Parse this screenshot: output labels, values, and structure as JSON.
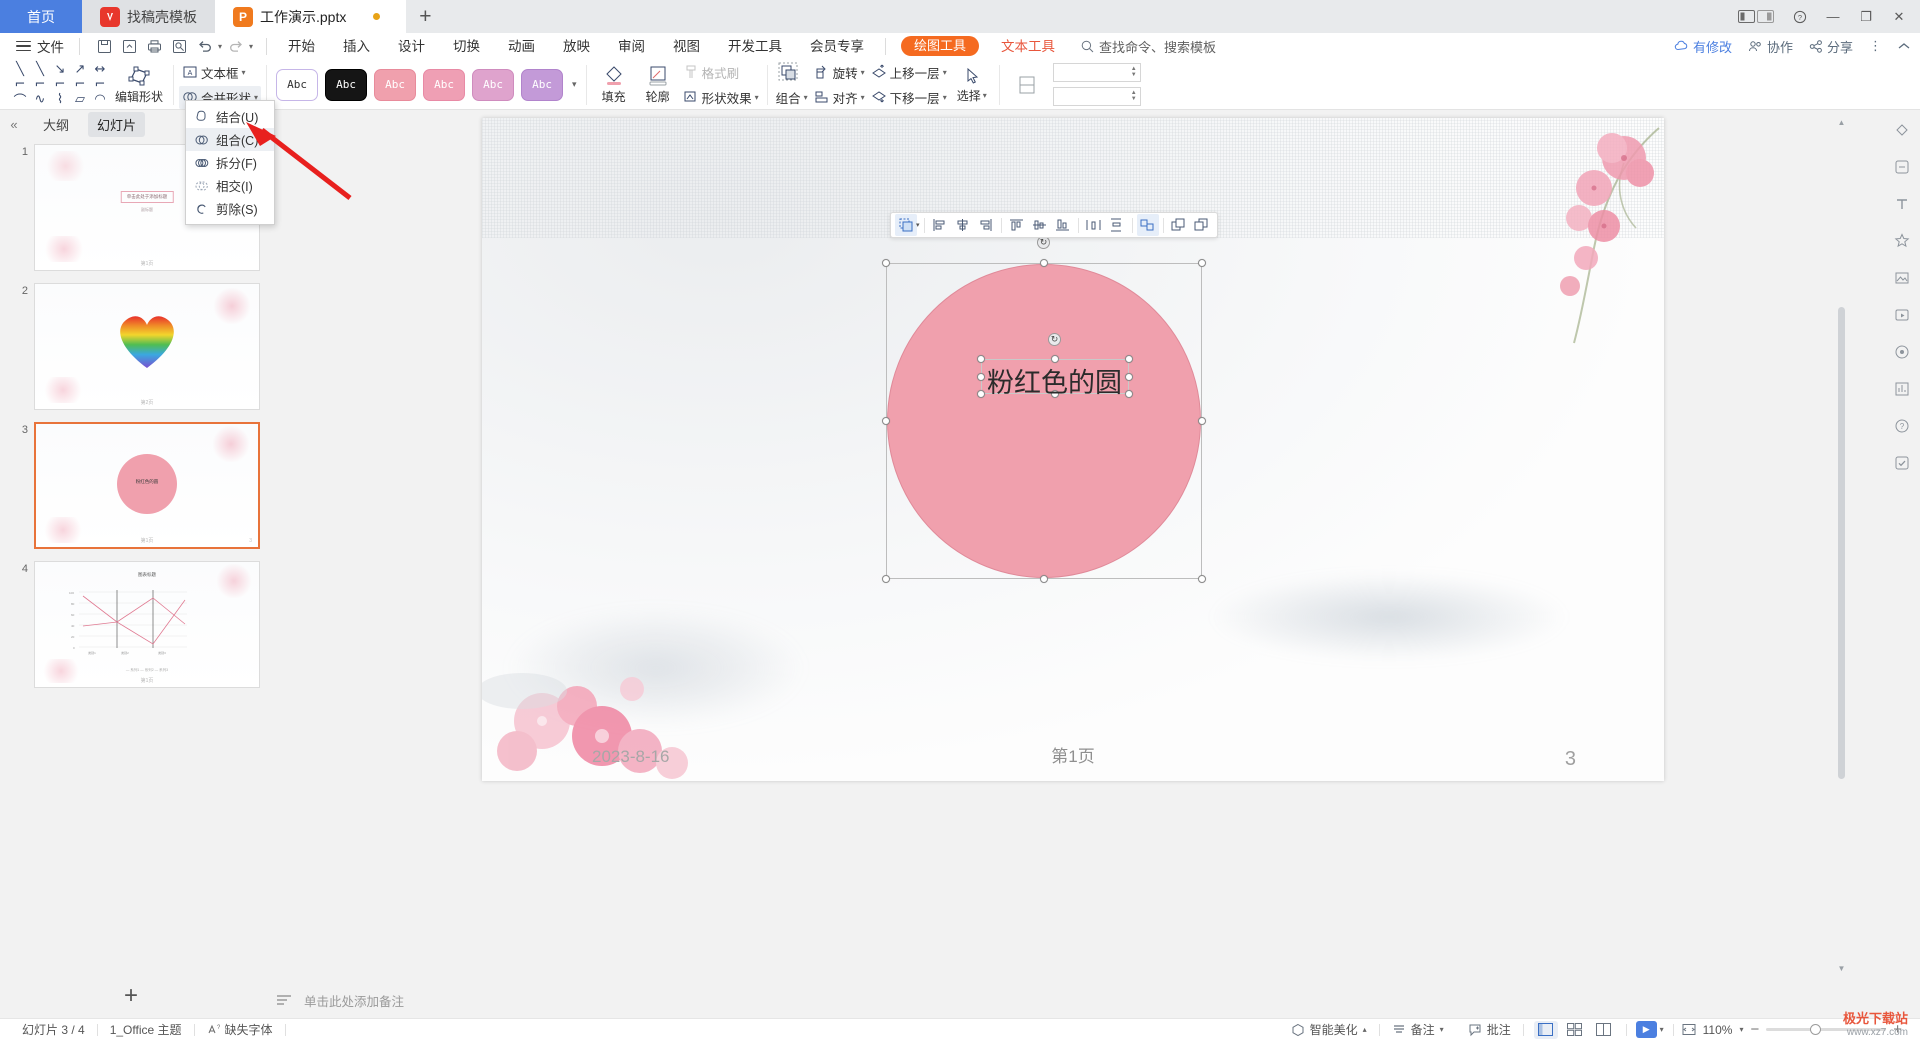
{
  "window": {
    "tabs": [
      {
        "label": "首页",
        "type": "home"
      },
      {
        "label": "找稿壳模板",
        "type": "inactive",
        "icon": "wps-red-icon"
      },
      {
        "label": "工作演示.pptx",
        "type": "active",
        "icon": "ppt-orange-icon"
      }
    ],
    "new_tab": "+",
    "controls": {
      "minimize": "—",
      "maximize": "❐",
      "close": "✕"
    }
  },
  "menubar": {
    "file": "文件",
    "quick_access": [
      "save-icon",
      "save-as-icon",
      "print-icon",
      "print-preview-icon",
      "undo-icon",
      "redo-icon",
      "customize-icon"
    ],
    "ribbon_tabs": [
      {
        "label": "开始"
      },
      {
        "label": "插入"
      },
      {
        "label": "设计"
      },
      {
        "label": "切换"
      },
      {
        "label": "动画"
      },
      {
        "label": "放映"
      },
      {
        "label": "审阅"
      },
      {
        "label": "视图"
      },
      {
        "label": "开发工具"
      },
      {
        "label": "会员专享"
      }
    ],
    "context_tabs": [
      {
        "label": "绘图工具",
        "style": "accent"
      },
      {
        "label": "文本工具",
        "style": "red"
      }
    ],
    "search_placeholder": "查找命令、搜索模板",
    "right_items": [
      {
        "label": "有修改",
        "icon": "cloud-icon"
      },
      {
        "label": "协作",
        "icon": "people-icon"
      },
      {
        "label": "分享",
        "icon": "share-icon"
      }
    ]
  },
  "ribbon": {
    "edit_shape": "编辑形状",
    "text_box": "文本框",
    "merge_shapes": "合并形状",
    "gallery_label": "Abc",
    "gallery_items": [
      {
        "fill": "#ffffff",
        "border": "#c6b6e8",
        "text": "#333333"
      },
      {
        "fill": "#151515",
        "border": "#000000",
        "text": "#ffffff"
      },
      {
        "fill": "#f0a0ad",
        "border": "#e88b9b",
        "text": "#ffffff"
      },
      {
        "fill": "#ef9fb4",
        "border": "#e88aa5",
        "text": "#ffffff"
      },
      {
        "fill": "#dfa3cd",
        "border": "#cf8cbe",
        "text": "#ffffff"
      },
      {
        "fill": "#c39ad8",
        "border": "#b184cc",
        "text": "#ffffff"
      }
    ],
    "fill": "填充",
    "outline": "轮廓",
    "shape_effect": "形状效果",
    "format_painter": "格式刷",
    "group": "组合",
    "align": "对齐",
    "rotate": "旋转",
    "move_up": "上移一层",
    "move_down": "下移一层",
    "select": "选择",
    "size_height": "",
    "size_width": ""
  },
  "dropdown": {
    "items": [
      {
        "label": "结合(U)",
        "icon": "union-icon",
        "highlighted": false
      },
      {
        "label": "组合(C)",
        "icon": "combine-icon",
        "highlighted": true
      },
      {
        "label": "拆分(F)",
        "icon": "fragment-icon",
        "highlighted": false
      },
      {
        "label": "相交(I)",
        "icon": "intersect-icon",
        "highlighted": false
      },
      {
        "label": "剪除(S)",
        "icon": "subtract-icon",
        "highlighted": false
      }
    ]
  },
  "slide_panel": {
    "collapse_icon": "collapse-left-icon",
    "tabs": [
      {
        "label": "大纲",
        "active": false
      },
      {
        "label": "幻灯片",
        "active": true
      }
    ],
    "slides": [
      {
        "num": "1",
        "selected": false,
        "kind": "title",
        "title": "单击此处于添加标题",
        "subtitle": "副标题",
        "footer": "第1页"
      },
      {
        "num": "2",
        "selected": false,
        "kind": "heart",
        "footer": "第2页"
      },
      {
        "num": "3",
        "selected": true,
        "kind": "circle",
        "label": "粉红色的圆",
        "footer": "第1页"
      },
      {
        "num": "4",
        "selected": false,
        "kind": "chart",
        "title": "图表标题",
        "footer": "第1页"
      }
    ],
    "add_slide": "+"
  },
  "slide": {
    "shape_text": "粉红色的圆",
    "footer_date": "2023-8-16",
    "footer_center": "第1页",
    "footer_number": "3",
    "shape_fill": "#f0a0ad"
  },
  "mini_toolbar": {
    "buttons": [
      "group-shapes-icon",
      "align-left-icon",
      "align-center-h-icon",
      "align-right-icon",
      "align-top-icon",
      "align-middle-icon",
      "align-bottom-icon",
      "distribute-h-icon",
      "distribute-v-icon",
      "group-icon",
      "bring-forward-icon",
      "send-backward-icon"
    ]
  },
  "notes": {
    "placeholder": "单击此处添加备注",
    "icon": "notes-icon"
  },
  "rail": {
    "icons": [
      "shape-fill-icon",
      "format-icon",
      "text-style-icon",
      "effects-icon",
      "picture-icon",
      "media-icon",
      "location-icon",
      "chart-icon",
      "help-icon",
      "check-icon"
    ]
  },
  "statusbar": {
    "slide_count": "幻灯片 3 / 4",
    "theme": "1_Office 主题",
    "missing_font": "缺失字体",
    "smart_beautify": "智能美化",
    "notes": "备注",
    "comment": "批注",
    "views": [
      "normal-view-icon",
      "slide-sorter-icon",
      "reading-view-icon"
    ],
    "play": "播放",
    "zoom_level": "110%",
    "zoom_out": "−",
    "zoom_in": "+",
    "fit_icon": "fit-screen-icon"
  },
  "watermark": {
    "line1": "极光下载站",
    "line2": "www.xz7.com"
  }
}
